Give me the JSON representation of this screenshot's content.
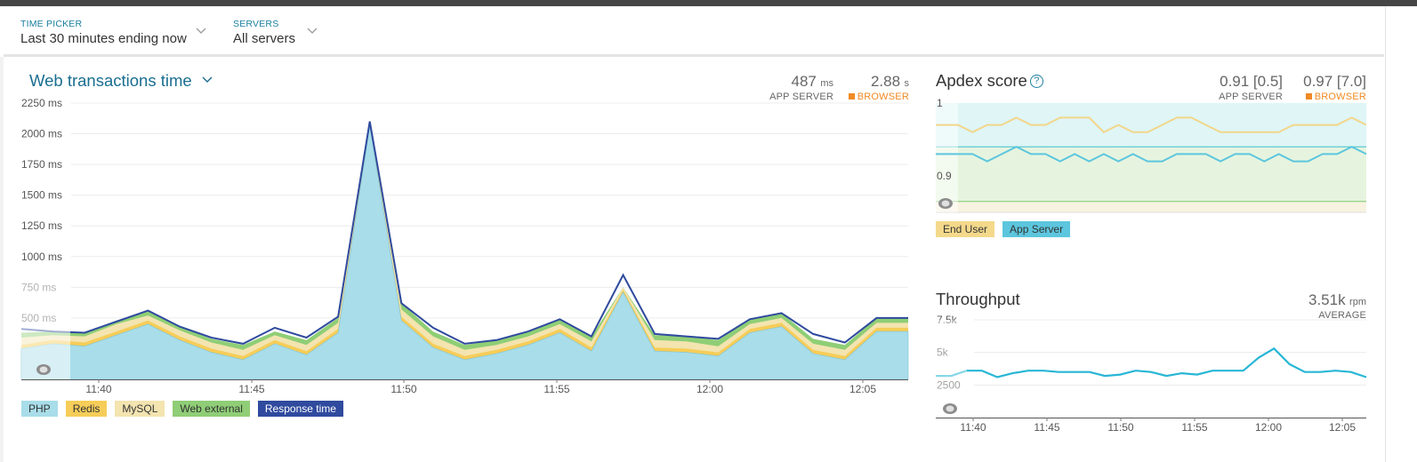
{
  "filters": [
    {
      "label": "TIME PICKER",
      "value": "Last 30 minutes ending now"
    },
    {
      "label": "SERVERS",
      "value": "All servers"
    }
  ],
  "web": {
    "title": "Web transactions time",
    "app_server": {
      "value": "487",
      "unit": "ms",
      "label": "APP SERVER"
    },
    "browser": {
      "value": "2.88",
      "unit": "s",
      "label": "BROWSER"
    },
    "y_ticks": [
      "2250 ms",
      "2000 ms",
      "1750 ms",
      "1500 ms",
      "1250 ms",
      "1000 ms",
      "750 ms",
      "500 ms",
      "250 ms"
    ],
    "x_ticks": [
      "11:40",
      "11:45",
      "11:50",
      "11:55",
      "12:00",
      "12:05"
    ],
    "legend": [
      {
        "name": "PHP",
        "color": "#a8dde9"
      },
      {
        "name": "Redis",
        "color": "#f6cd58"
      },
      {
        "name": "MySQL",
        "color": "#f3e4b0"
      },
      {
        "name": "Web external",
        "color": "#8fce76"
      },
      {
        "name": "Response time",
        "color": "#2f4a9e"
      }
    ]
  },
  "apdex": {
    "title": "Apdex score",
    "help_icon": "?",
    "app_server": {
      "value": "0.91 [0.5]",
      "label": "APP SERVER"
    },
    "browser": {
      "value": "0.97 [7.0]",
      "label": "BROWSER"
    },
    "y_ticks": [
      "1",
      "0.9"
    ],
    "legend": [
      {
        "name": "End User",
        "color": "#f4d98b"
      },
      {
        "name": "App Server",
        "color": "#5cc6de"
      }
    ]
  },
  "throughput": {
    "title": "Throughput",
    "value": "3.51k",
    "unit": "rpm",
    "label": "AVERAGE",
    "y_ticks": [
      "7.5k",
      "5k",
      "2500"
    ],
    "x_ticks": [
      "11:40",
      "11:45",
      "11:50",
      "11:55",
      "12:00",
      "12:05"
    ]
  },
  "chart_data": [
    {
      "type": "area",
      "title": "Web transactions time",
      "ylabel": "ms",
      "ylim": [
        0,
        2250
      ],
      "categories": [
        "11:38",
        "11:39",
        "11:40",
        "11:41",
        "11:42",
        "11:43",
        "11:44",
        "11:45",
        "11:46",
        "11:47",
        "11:48",
        "11:49",
        "11:50",
        "11:51",
        "11:52",
        "11:53",
        "11:54",
        "11:55",
        "11:56",
        "11:57",
        "11:58",
        "11:59",
        "12:00",
        "12:01",
        "12:02",
        "12:03",
        "12:04",
        "12:05",
        "12:06"
      ],
      "series": [
        {
          "name": "PHP",
          "values": [
            250,
            290,
            270,
            360,
            450,
            320,
            220,
            160,
            290,
            200,
            380,
            2060,
            480,
            260,
            160,
            210,
            280,
            380,
            230,
            710,
            230,
            220,
            190,
            380,
            430,
            210,
            160,
            390,
            390
          ]
        },
        {
          "name": "Redis",
          "values": [
            30,
            30,
            30,
            30,
            30,
            30,
            30,
            30,
            30,
            30,
            30,
            20,
            30,
            30,
            30,
            30,
            30,
            30,
            30,
            20,
            30,
            30,
            30,
            30,
            30,
            30,
            30,
            30,
            30
          ]
        },
        {
          "name": "MySQL",
          "values": [
            60,
            40,
            50,
            60,
            40,
            50,
            50,
            50,
            40,
            50,
            50,
            20,
            60,
            60,
            50,
            40,
            40,
            40,
            50,
            20,
            60,
            60,
            50,
            40,
            40,
            50,
            50,
            40,
            40
          ]
        },
        {
          "name": "Web external",
          "values": [
            40,
            30,
            30,
            30,
            40,
            30,
            30,
            40,
            30,
            40,
            40,
            0,
            50,
            40,
            40,
            40,
            40,
            40,
            40,
            0,
            40,
            40,
            50,
            40,
            40,
            40,
            40,
            40,
            40
          ]
        },
        {
          "name": "Response time",
          "values": [
            410,
            390,
            380,
            470,
            560,
            430,
            340,
            290,
            420,
            340,
            510,
            2100,
            620,
            420,
            290,
            320,
            390,
            490,
            350,
            850,
            370,
            350,
            330,
            490,
            540,
            370,
            300,
            500,
            500
          ]
        }
      ]
    },
    {
      "type": "line",
      "title": "Apdex score",
      "ylim": [
        0.85,
        1
      ],
      "categories": [
        "11:38",
        "11:39",
        "11:40",
        "11:41",
        "11:42",
        "11:43",
        "11:44",
        "11:45",
        "11:46",
        "11:47",
        "11:48",
        "11:49",
        "11:50",
        "11:51",
        "11:52",
        "11:53",
        "11:54",
        "11:55",
        "11:56",
        "11:57",
        "11:58",
        "11:59",
        "12:00",
        "12:01",
        "12:02",
        "12:03",
        "12:04",
        "12:05",
        "12:06"
      ],
      "series": [
        {
          "name": "End User",
          "values": [
            0.97,
            0.96,
            0.97,
            0.97,
            0.98,
            0.97,
            0.97,
            0.98,
            0.98,
            0.98,
            0.96,
            0.97,
            0.96,
            0.96,
            0.97,
            0.98,
            0.98,
            0.97,
            0.96,
            0.96,
            0.96,
            0.96,
            0.96,
            0.97,
            0.97,
            0.97,
            0.97,
            0.98,
            0.97
          ]
        },
        {
          "name": "App Server",
          "values": [
            0.93,
            0.93,
            0.92,
            0.93,
            0.94,
            0.93,
            0.93,
            0.92,
            0.93,
            0.92,
            0.93,
            0.92,
            0.93,
            0.92,
            0.92,
            0.93,
            0.93,
            0.93,
            0.92,
            0.93,
            0.93,
            0.92,
            0.93,
            0.92,
            0.92,
            0.93,
            0.93,
            0.94,
            0.93
          ]
        }
      ]
    },
    {
      "type": "line",
      "title": "Throughput",
      "ylabel": "rpm",
      "ylim": [
        0,
        7500
      ],
      "categories": [
        "11:38",
        "11:39",
        "11:40",
        "11:41",
        "11:42",
        "11:43",
        "11:44",
        "11:45",
        "11:46",
        "11:47",
        "11:48",
        "11:49",
        "11:50",
        "11:51",
        "11:52",
        "11:53",
        "11:54",
        "11:55",
        "11:56",
        "11:57",
        "11:58",
        "11:59",
        "12:00",
        "12:01",
        "12:02",
        "12:03",
        "12:04",
        "12:05",
        "12:06"
      ],
      "series": [
        {
          "name": "Throughput",
          "values": [
            3200,
            3200,
            3600,
            3600,
            3100,
            3400,
            3600,
            3600,
            3500,
            3500,
            3500,
            3200,
            3300,
            3600,
            3500,
            3200,
            3400,
            3300,
            3600,
            3600,
            3600,
            4600,
            5300,
            4100,
            3500,
            3500,
            3600,
            3500,
            3100
          ]
        }
      ]
    }
  ]
}
